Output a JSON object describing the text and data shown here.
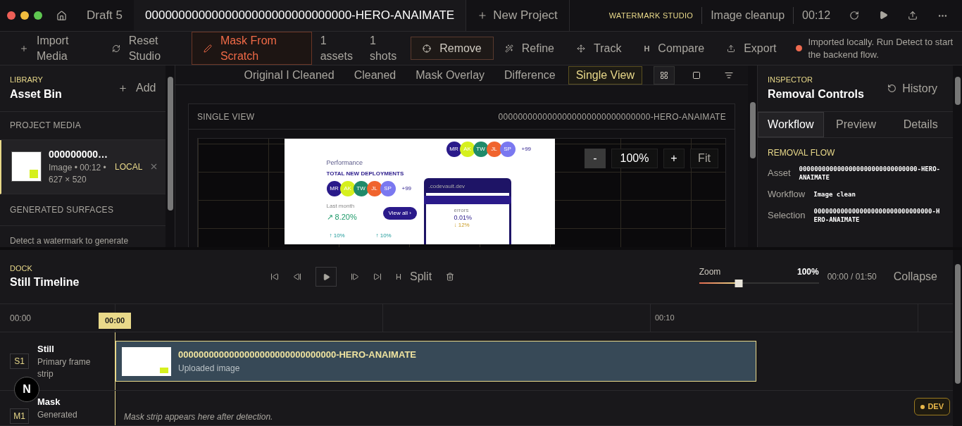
{
  "header": {
    "draft": "Draft 5",
    "project_title": "0000000000000000000000000000000-HERO-ANAIMATE",
    "new_project": "New Project",
    "brand": "WATERMARK STUDIO",
    "mode": "Image cleanup",
    "time": "00:12"
  },
  "toolbar": {
    "tools": [
      {
        "label": "Import Media",
        "kind": "plain"
      },
      {
        "label": "Reset Studio",
        "kind": "plain"
      },
      {
        "label": "Mask From Scratch",
        "kind": "accent"
      }
    ],
    "counts": [
      {
        "value": "1",
        "unit": "assets"
      },
      {
        "value": "1",
        "unit": "shots"
      }
    ],
    "actions": [
      {
        "label": "Remove",
        "kind": "outline"
      },
      {
        "label": "Refine",
        "kind": "plain"
      },
      {
        "label": "Track",
        "kind": "plain"
      },
      {
        "label": "Compare",
        "kind": "plain",
        "key": "H"
      },
      {
        "label": "Export",
        "kind": "plain"
      }
    ],
    "status": {
      "message": "Imported locally. Run Detect to start the backend flow.",
      "color": "#ee6a4f"
    }
  },
  "library": {
    "eyebrow": "LIBRARY",
    "title": "Asset Bin",
    "add": "Add",
    "project_media": "PROJECT MEDIA",
    "media": [
      {
        "name": "000000000…",
        "meta": "Image • 00:12 • 627 × 520",
        "badge": "LOCAL",
        "selected": true
      }
    ],
    "generated": "GENERATED SURFACES",
    "generated_hint": "Detect a watermark to generate"
  },
  "viewer": {
    "tabs": [
      {
        "label": "Original I Cleaned",
        "selected": false
      },
      {
        "label": "Cleaned",
        "selected": false
      },
      {
        "label": "Mask Overlay",
        "selected": false
      },
      {
        "label": "Difference",
        "selected": false
      },
      {
        "label": "Single View",
        "selected": true
      }
    ],
    "layout_buttons": [
      {
        "selected": true
      },
      {
        "selected": false
      },
      {
        "selected": false
      }
    ],
    "panel_label": "SINGLE VIEW",
    "panel_title": "0000000000000000000000000000000-HERO-ANAIMATE",
    "zoom": {
      "minus": "-",
      "value": "100%",
      "plus": "+",
      "fit": "Fit"
    },
    "preview": {
      "section": "Performance",
      "heading": "TOTAL NEW DEPLOYMENTS",
      "avatars": [
        {
          "initials": "MR",
          "color": "#2a1a8a"
        },
        {
          "initials": "AK",
          "color": "#d6f01e"
        },
        {
          "initials": "TW",
          "color": "#1f8a6a"
        },
        {
          "initials": "JL",
          "color": "#f0642e"
        },
        {
          "initials": "SP",
          "color": "#7a78f0"
        }
      ],
      "top_avatars": [
        {
          "initials": "MR",
          "color": "#2a1a8a"
        },
        {
          "initials": "AK",
          "color": "#d6f01e"
        },
        {
          "initials": "TW",
          "color": "#1f8a6a"
        },
        {
          "initials": "JL",
          "color": "#f0642e"
        },
        {
          "initials": "SP",
          "color": "#7a78f0"
        }
      ],
      "more": "+99",
      "top_more": "+99",
      "period": "Last month",
      "growth": "↗ 8.20%",
      "view_all": "View all ›",
      "url": ".codevault.dev",
      "stat_label": "errors",
      "stat_value": "0.01%",
      "stat_delta": "↓ 12%",
      "deltas": [
        "↑ 10%",
        "↑ 10%"
      ]
    }
  },
  "inspector": {
    "eyebrow": "INSPECTOR",
    "title": "Removal Controls",
    "history": "History",
    "tabs": [
      {
        "label": "Workflow",
        "selected": true
      },
      {
        "label": "Preview",
        "selected": false
      },
      {
        "label": "Details",
        "selected": false
      }
    ],
    "section": "REMOVAL FLOW",
    "rows": [
      {
        "label": "Asset",
        "value": "0000000000000000000000000000000-HERO-ANAIMATE"
      },
      {
        "label": "Workflow",
        "value": "Image clean"
      },
      {
        "label": "Selection",
        "value": "0000000000000000000000000000000-HERO-ANAIMATE"
      }
    ]
  },
  "dock": {
    "eyebrow": "DOCK",
    "title": "Still Timeline",
    "split": "Split",
    "split_key": "H",
    "zoom_label": "Zoom",
    "zoom_value": "100%",
    "zoom": {
      "level": 0.33
    },
    "time": "00:00 / 01:50",
    "collapse": "Collapse",
    "ruler": {
      "start": "00:00",
      "playhead": "00:00",
      "ticks": [
        "00:10"
      ]
    },
    "tracks": [
      {
        "code": "S1",
        "name": "Still",
        "sub": "Primary frame strip",
        "clip": {
          "title": "0000000000000000000000000000000-HERO-ANAIMATE",
          "sub": "Uploaded image"
        }
      },
      {
        "code": "M1",
        "name": "Mask",
        "sub": "Generated",
        "empty": "Mask strip appears here after detection."
      }
    ],
    "dev_badge": "DEV",
    "corner_badge": "N"
  }
}
